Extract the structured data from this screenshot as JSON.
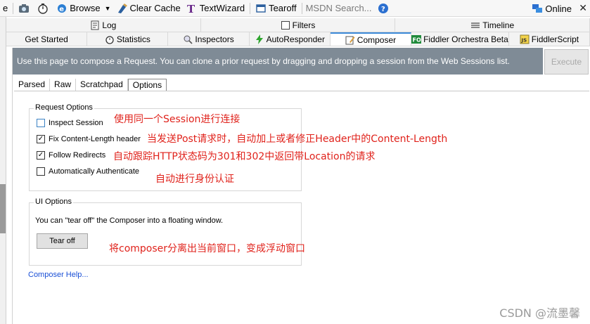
{
  "toolbar": {
    "partial_label": "e",
    "browse": "Browse",
    "clear_cache": "Clear Cache",
    "textwizard": "TextWizard",
    "tearoff": "Tearoff",
    "search_placeholder": "MSDN Search...",
    "online": "Online"
  },
  "tabs_row1": [
    {
      "label": "Log",
      "icon": "log-icon"
    },
    {
      "label": "Filters",
      "icon": "filters-icon"
    },
    {
      "label": "Timeline",
      "icon": "timeline-icon"
    }
  ],
  "tabs_row2": [
    {
      "label": "Get Started",
      "icon": ""
    },
    {
      "label": "Statistics",
      "icon": "stopwatch-icon"
    },
    {
      "label": "Inspectors",
      "icon": "inspectors-icon"
    },
    {
      "label": "AutoResponder",
      "icon": "lightning-icon"
    },
    {
      "label": "Composer",
      "icon": "composer-icon",
      "active": true
    },
    {
      "label": "Fiddler Orchestra Beta",
      "icon": "fo-icon"
    },
    {
      "label": "FiddlerScript",
      "icon": "js-icon"
    }
  ],
  "composer": {
    "banner": "Use this page to compose a Request. You can clone a prior request by dragging and dropping a session from the Web Sessions list.",
    "execute": "Execute",
    "subtabs": [
      "Parsed",
      "Raw",
      "Scratchpad",
      "Options"
    ],
    "active_subtab": "Options",
    "request_options": {
      "title": "Request Options",
      "items": [
        {
          "label": "Inspect Session",
          "checked": false
        },
        {
          "label": "Fix Content-Length header",
          "checked": true
        },
        {
          "label": "Follow Redirects",
          "checked": true
        },
        {
          "label": "Automatically Authenticate",
          "checked": false
        }
      ]
    },
    "ui_options": {
      "title": "UI Options",
      "text": "You can \"tear off\" the Composer into a floating window.",
      "button": "Tear off"
    },
    "help_link": "Composer Help..."
  },
  "annotations": [
    "使用同一个Session进行连接",
    "当发送Post请求时，自动加上或者修正Header中的Content-Length",
    "自动跟踪HTTP状态码为301和302中返回带Location的请求",
    "自动进行身份认证",
    "将composer分离出当前窗口，变成浮动窗口"
  ],
  "watermark": "CSDN @流墨馨",
  "colors": {
    "banner_bg": "#7f8b96",
    "annotation": "#e0221b",
    "link": "#1a4fd6",
    "active_tab_accent": "#3c8ad8"
  }
}
